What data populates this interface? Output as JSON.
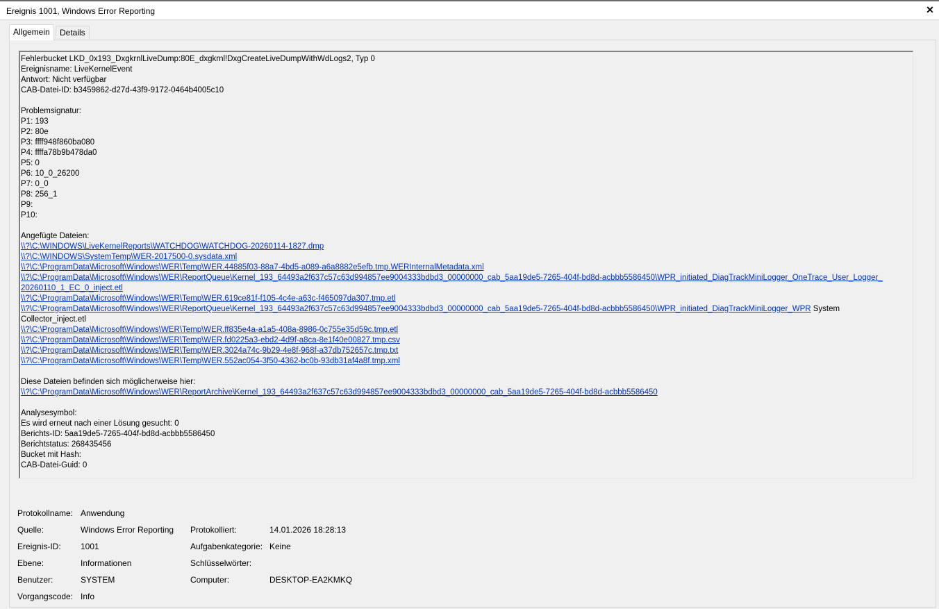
{
  "window": {
    "title": "Ereignis 1001, Windows Error Reporting"
  },
  "tabs": [
    {
      "label": "Allgemein"
    },
    {
      "label": "Details"
    }
  ],
  "description": {
    "header_lines": [
      "Fehlerbucket LKD_0x193_DxgkrnlLiveDump:80E_dxgkrnl!DxgCreateLiveDumpWithWdLogs2, Typ 0",
      "Ereignisname: LiveKernelEvent",
      "Antwort: Nicht verfügbar",
      "CAB-Datei-ID: b3459862-d27d-43f9-9172-0464b4005c10"
    ],
    "signature_title": "Problemsignatur:",
    "signature_lines": [
      "P1: 193",
      "P2: 80e",
      "P3: ffff948f860ba080",
      "P4: ffffa78b9b478da0",
      "P5: 0",
      "P6: 10_0_26200",
      "P7: 0_0",
      "P8: 256_1",
      "P9:",
      "P10:"
    ],
    "attached_title": "Angefügte Dateien:",
    "attached_files": [
      {
        "link": "\\\\?\\C:\\WINDOWS\\LiveKernelReports\\WATCHDOG\\WATCHDOG-20260114-1827.dmp",
        "text": ""
      },
      {
        "link": "\\\\?\\C:\\WINDOWS\\SystemTemp\\WER-2017500-0.sysdata.xml",
        "text": ""
      },
      {
        "link": "\\\\?\\C:\\ProgramData\\Microsoft\\Windows\\WER\\Temp\\WER.44885f03-88a7-4bd5-a089-a6a8882e5efb.tmp.WERInternalMetadata.xml",
        "text": ""
      },
      {
        "link": "\\\\?\\C:\\ProgramData\\Microsoft\\Windows\\WER\\ReportQueue\\Kernel_193_64493a2f637c57c63d994857ee9004333bdbd3_00000000_cab_5aa19de5-7265-404f-bd8d-acbbb5586450\\WPR_initiated_DiagTrackMiniLogger_OneTrace_User_Logger_",
        "link2": "20260110_1_EC_0_inject.etl",
        "text": ""
      },
      {
        "link": "\\\\?\\C:\\ProgramData\\Microsoft\\Windows\\WER\\Temp\\WER.619ce81f-f105-4c4e-a63c-f465097da307.tmp.etl",
        "text": ""
      },
      {
        "link": "\\\\?\\C:\\ProgramData\\Microsoft\\Windows\\WER\\ReportQueue\\Kernel_193_64493a2f637c57c63d994857ee9004333bdbd3_00000000_cab_5aa19de5-7265-404f-bd8d-acbbb5586450\\WPR_initiated_DiagTrackMiniLogger_WPR",
        "text": " System",
        "cont": "Collector_inject.etl"
      },
      {
        "link": "\\\\?\\C:\\ProgramData\\Microsoft\\Windows\\WER\\Temp\\WER.ff835e4a-a1a5-408a-8986-0c755e35d59c.tmp.etl",
        "text": ""
      },
      {
        "link": "\\\\?\\C:\\ProgramData\\Microsoft\\Windows\\WER\\Temp\\WER.fd0225a3-ebd2-4d9f-a8ca-8e1f40e00827.tmp.csv",
        "text": ""
      },
      {
        "link": "\\\\?\\C:\\ProgramData\\Microsoft\\Windows\\WER\\Temp\\WER.3024a74c-9b29-4e8f-968f-a37db752657c.tmp.txt",
        "text": ""
      },
      {
        "link": "\\\\?\\C:\\ProgramData\\Microsoft\\Windows\\WER\\Temp\\WER.552ac054-3f50-4362-bc0b-93db31af4a8f.tmp.xml",
        "text": ""
      }
    ],
    "location_title": "Diese Dateien befinden sich möglicherweise hier:",
    "location_link": "\\\\?\\C:\\ProgramData\\Microsoft\\Windows\\WER\\ReportArchive\\Kernel_193_64493a2f637c57c63d994857ee9004333bdbd3_00000000_cab_5aa19de5-7265-404f-bd8d-acbbb5586450",
    "analysis_lines": [
      "Analysesymbol:",
      "Es wird erneut nach einer Lösung gesucht: 0",
      "Berichts-ID: 5aa19de5-7265-404f-bd8d-acbbb5586450",
      "Berichtstatus: 268435456",
      "Bucket mit Hash:",
      "CAB-Datei-Guid: 0"
    ]
  },
  "properties": {
    "protokollname": {
      "label": "Protokollname:",
      "value": "Anwendung"
    },
    "quelle": {
      "label": "Quelle:",
      "value": "Windows Error Reporting"
    },
    "protokolliert": {
      "label": "Protokolliert:",
      "value": "14.01.2026 18:28:13"
    },
    "ereignis_id": {
      "label": "Ereignis-ID:",
      "value": "1001"
    },
    "aufgabenkategorie": {
      "label": "Aufgabenkategorie:",
      "value": "Keine"
    },
    "ebene": {
      "label": "Ebene:",
      "value": "Informationen"
    },
    "schluesselwoerter": {
      "label": "Schlüsselwörter:",
      "value": ""
    },
    "benutzer": {
      "label": "Benutzer:",
      "value": "SYSTEM"
    },
    "computer": {
      "label": "Computer:",
      "value": "DESKTOP-EA2KMKQ"
    },
    "vorgangscode": {
      "label": "Vorgangscode:",
      "value": "Info"
    }
  }
}
